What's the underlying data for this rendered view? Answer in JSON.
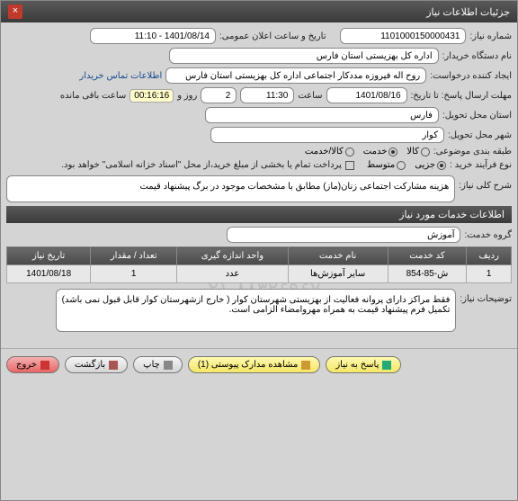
{
  "window": {
    "title": "جزئیات اطلاعات نیاز",
    "close": "×"
  },
  "fields": {
    "need_no_label": "شماره نیاز:",
    "need_no": "1101000150000431",
    "announce_label": "تاریخ و ساعت اعلان عمومی:",
    "announce_value": "1401/08/14 - 11:10",
    "buyer_label": "نام دستگاه خریدار:",
    "buyer": "اداره کل بهزیستی استان فارس",
    "creator_label": "ایجاد کننده درخواست:",
    "creator": "روح اله فیروزه مددکار اجتماعی اداره کل بهزیستی استان فارس",
    "contact_link": "اطلاعات تماس خریدار",
    "deadline_label": "مهلت ارسال پاسخ: تا تاریخ:",
    "deadline_date": "1401/08/16",
    "time_label": "ساعت",
    "deadline_time": "11:30",
    "days_label": "روز و",
    "days": "2",
    "countdown": "00:16:16",
    "remain_label": "ساعت باقی مانده",
    "province_label": "استان محل تحویل:",
    "province": "فارس",
    "city_label": "شهر محل تحویل:",
    "city": "کوار",
    "class_label": "طبقه بندی موضوعی:",
    "kala": "کالا",
    "service": "خدمت",
    "kala_service": "کالا/خدمت",
    "proc_label": "نوع فرآیند خرید :",
    "tiny": "جزیی",
    "medium": "متوسط",
    "pay_note": "پرداخت تمام یا بخشی از مبلغ خرید،از محل \"اسناد خزانه اسلامی\" خواهد بود."
  },
  "desc_section": {
    "label": "شرح کلی نیاز:",
    "text": "هزینه مشارکت اجتماعی زنان(ماز) مطابق با مشخصات موجود در برگ پیشنهاد قیمت"
  },
  "services_header": "اطلاعات خدمات مورد نیاز",
  "service_group_label": "گروه خدمت:",
  "service_group": "آموزش",
  "table": {
    "headers": [
      "ردیف",
      "کد خدمت",
      "نام خدمت",
      "واحد اندازه گیری",
      "تعداد / مقدار",
      "تاریخ نیاز"
    ],
    "row": [
      "1",
      "ش-85-854",
      "سایر آموزش‌ها",
      "عدد",
      "1",
      "1401/08/18"
    ]
  },
  "notes_label": "توضیحات نیاز:",
  "notes": "فقط مراکز دارای پروانه فعالیت از بهزیستی شهرستان کوار ( خارج ازشهرستان  کوار  قابل قبول نمی باشد)\nتکمیل فرم پیشنهاد قیمت به همراه مهروامضاء الزامی است.",
  "watermark": "۰۲۱-۸۸۳۲۶۹۶۷",
  "buttons": {
    "reply": "پاسخ به نیاز",
    "attach": "مشاهده مدارک پیوستی (1)",
    "print": "چاپ",
    "back": "بازگشت",
    "exit": "خروج"
  }
}
